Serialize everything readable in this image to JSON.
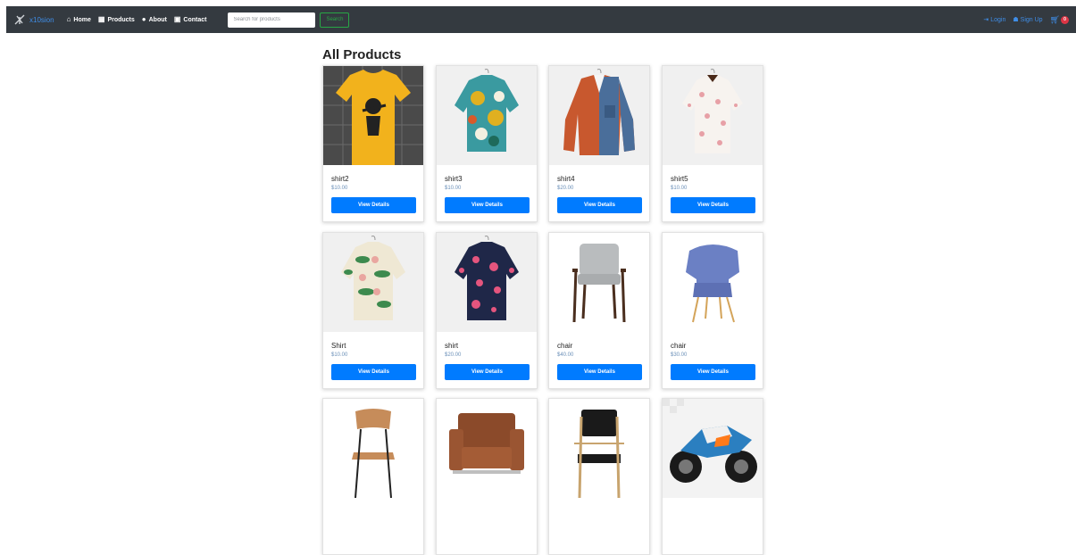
{
  "brand": {
    "name": "x10sion"
  },
  "nav": {
    "links": [
      {
        "label": "Home",
        "icon": "home-icon"
      },
      {
        "label": "Products",
        "icon": "grid-icon"
      },
      {
        "label": "About",
        "icon": "info-circle-icon"
      },
      {
        "label": "Contact",
        "icon": "contact-card-icon"
      }
    ],
    "search_placeholder": "Search for products",
    "search_button": "Search",
    "login": "Login",
    "signup": "Sign Up",
    "cart_count": "0"
  },
  "colors": {
    "navbar": "#343a40",
    "accent": "#007bff",
    "search": "#28a745",
    "badge": "#dc3545"
  },
  "page_title": "All Products",
  "products": [
    {
      "name": "shirt2",
      "price": "$10.00",
      "button": "View Details",
      "image": "yellow-tshirt"
    },
    {
      "name": "shirt3",
      "price": "$10.00",
      "button": "View Details",
      "image": "floral-shirt"
    },
    {
      "name": "shirt4",
      "price": "$20.00",
      "button": "View Details",
      "image": "orange-denim-shirt"
    },
    {
      "name": "shirt5",
      "price": "$10.00",
      "button": "View Details",
      "image": "white-floral-shirt"
    },
    {
      "name": "Shirt",
      "price": "$10.00",
      "button": "View Details",
      "image": "green-floral-shirt"
    },
    {
      "name": "shirt",
      "price": "$20.00",
      "button": "View Details",
      "image": "navy-floral-shirt"
    },
    {
      "name": "chair",
      "price": "$40.00",
      "button": "View Details",
      "image": "gray-armchair"
    },
    {
      "name": "chair",
      "price": "$30.00",
      "button": "View Details",
      "image": "blue-wingchair"
    },
    {
      "name": "",
      "price": "",
      "button": "",
      "image": "wooden-chair"
    },
    {
      "name": "",
      "price": "",
      "button": "",
      "image": "leather-armchair"
    },
    {
      "name": "",
      "price": "",
      "button": "",
      "image": "black-wood-chair"
    },
    {
      "name": "",
      "price": "",
      "button": "",
      "image": "motorcycle"
    }
  ]
}
